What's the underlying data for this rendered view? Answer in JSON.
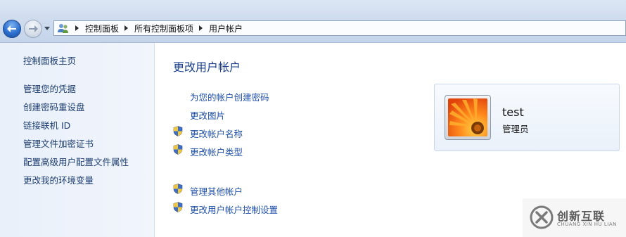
{
  "breadcrumb": [
    "控制面板",
    "所有控制面板项",
    "用户帐户"
  ],
  "sidebar": {
    "home": "控制面板主页",
    "items": [
      "管理您的凭据",
      "创建密码重设盘",
      "链接联机 ID",
      "管理文件加密证书",
      "配置高级用户配置文件属性",
      "更改我的环境变量"
    ]
  },
  "main": {
    "title": "更改用户帐户",
    "tasks": [
      {
        "label": "为您的帐户创建密码",
        "icon": "none"
      },
      {
        "label": "更改图片",
        "icon": "none"
      },
      {
        "label": "更改帐户名称",
        "icon": "uac-shield-icon"
      },
      {
        "label": "更改帐户类型",
        "icon": "uac-shield-icon"
      }
    ],
    "other_tasks": [
      {
        "label": "管理其他帐户",
        "icon": "uac-shield-icon"
      },
      {
        "label": "更改用户帐户控制设置",
        "icon": "uac-shield-icon"
      }
    ]
  },
  "account": {
    "name": "test",
    "role": "管理员"
  },
  "watermark": {
    "text": "创新互联",
    "sub": "CHUANG XIN HU LIAN"
  },
  "colors": {
    "link": "#1e4fa8",
    "title": "#1a3e8c",
    "sidebar_bg": "#eef3fb"
  }
}
